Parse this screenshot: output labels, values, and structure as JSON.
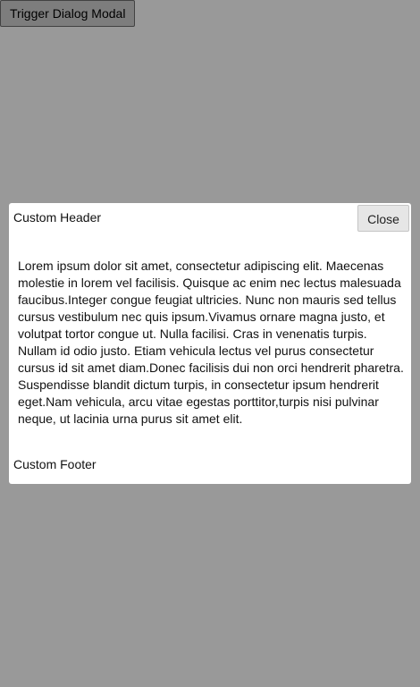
{
  "trigger": {
    "label": "Trigger Dialog Modal"
  },
  "dialog": {
    "header": "Custom Header",
    "close_label": "Close",
    "body": "Lorem ipsum dolor sit amet, consectetur adipiscing elit. Maecenas molestie in lorem vel facilisis. Quisque ac enim nec lectus malesuada faucibus.Integer congue feugiat ultricies. Nunc non mauris sed tellus cursus vestibulum nec quis ipsum.Vivamus ornare magna justo, et volutpat tortor congue ut. Nulla facilisi. Cras in venenatis turpis. Nullam id odio justo. Etiam vehicula lectus vel purus consectetur cursus id sit amet diam.Donec facilisis dui non orci hendrerit pharetra. Suspendisse blandit dictum turpis, in consectetur ipsum hendrerit eget.Nam vehicula, arcu vitae egestas porttitor,turpis nisi pulvinar neque, ut lacinia urna purus sit amet elit.",
    "footer": "Custom Footer"
  },
  "colors": {
    "overlay": "#999999",
    "dialog_background": "#ffffff",
    "button_background": "#e6e6e6"
  }
}
